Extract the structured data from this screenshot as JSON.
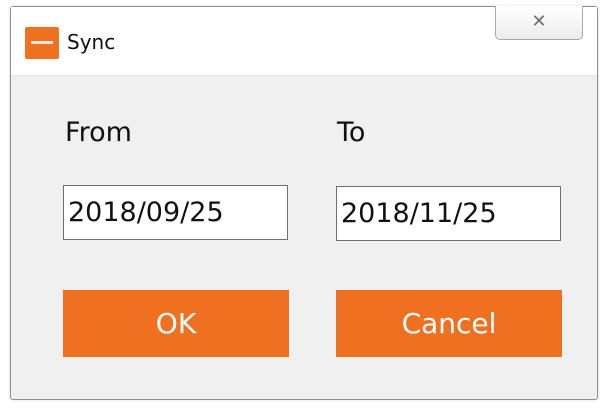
{
  "window": {
    "title": "Sync",
    "close_glyph": "✕",
    "app_icon": "app-logo-icon"
  },
  "form": {
    "from_label": "From",
    "to_label": "To",
    "from_value": "2018/09/25",
    "to_value": "2018/11/25"
  },
  "buttons": {
    "ok_label": "OK",
    "cancel_label": "Cancel"
  },
  "colors": {
    "accent": "#f07022",
    "dialog_background": "#f0f0f0",
    "titlebar_background": "#ffffff"
  }
}
